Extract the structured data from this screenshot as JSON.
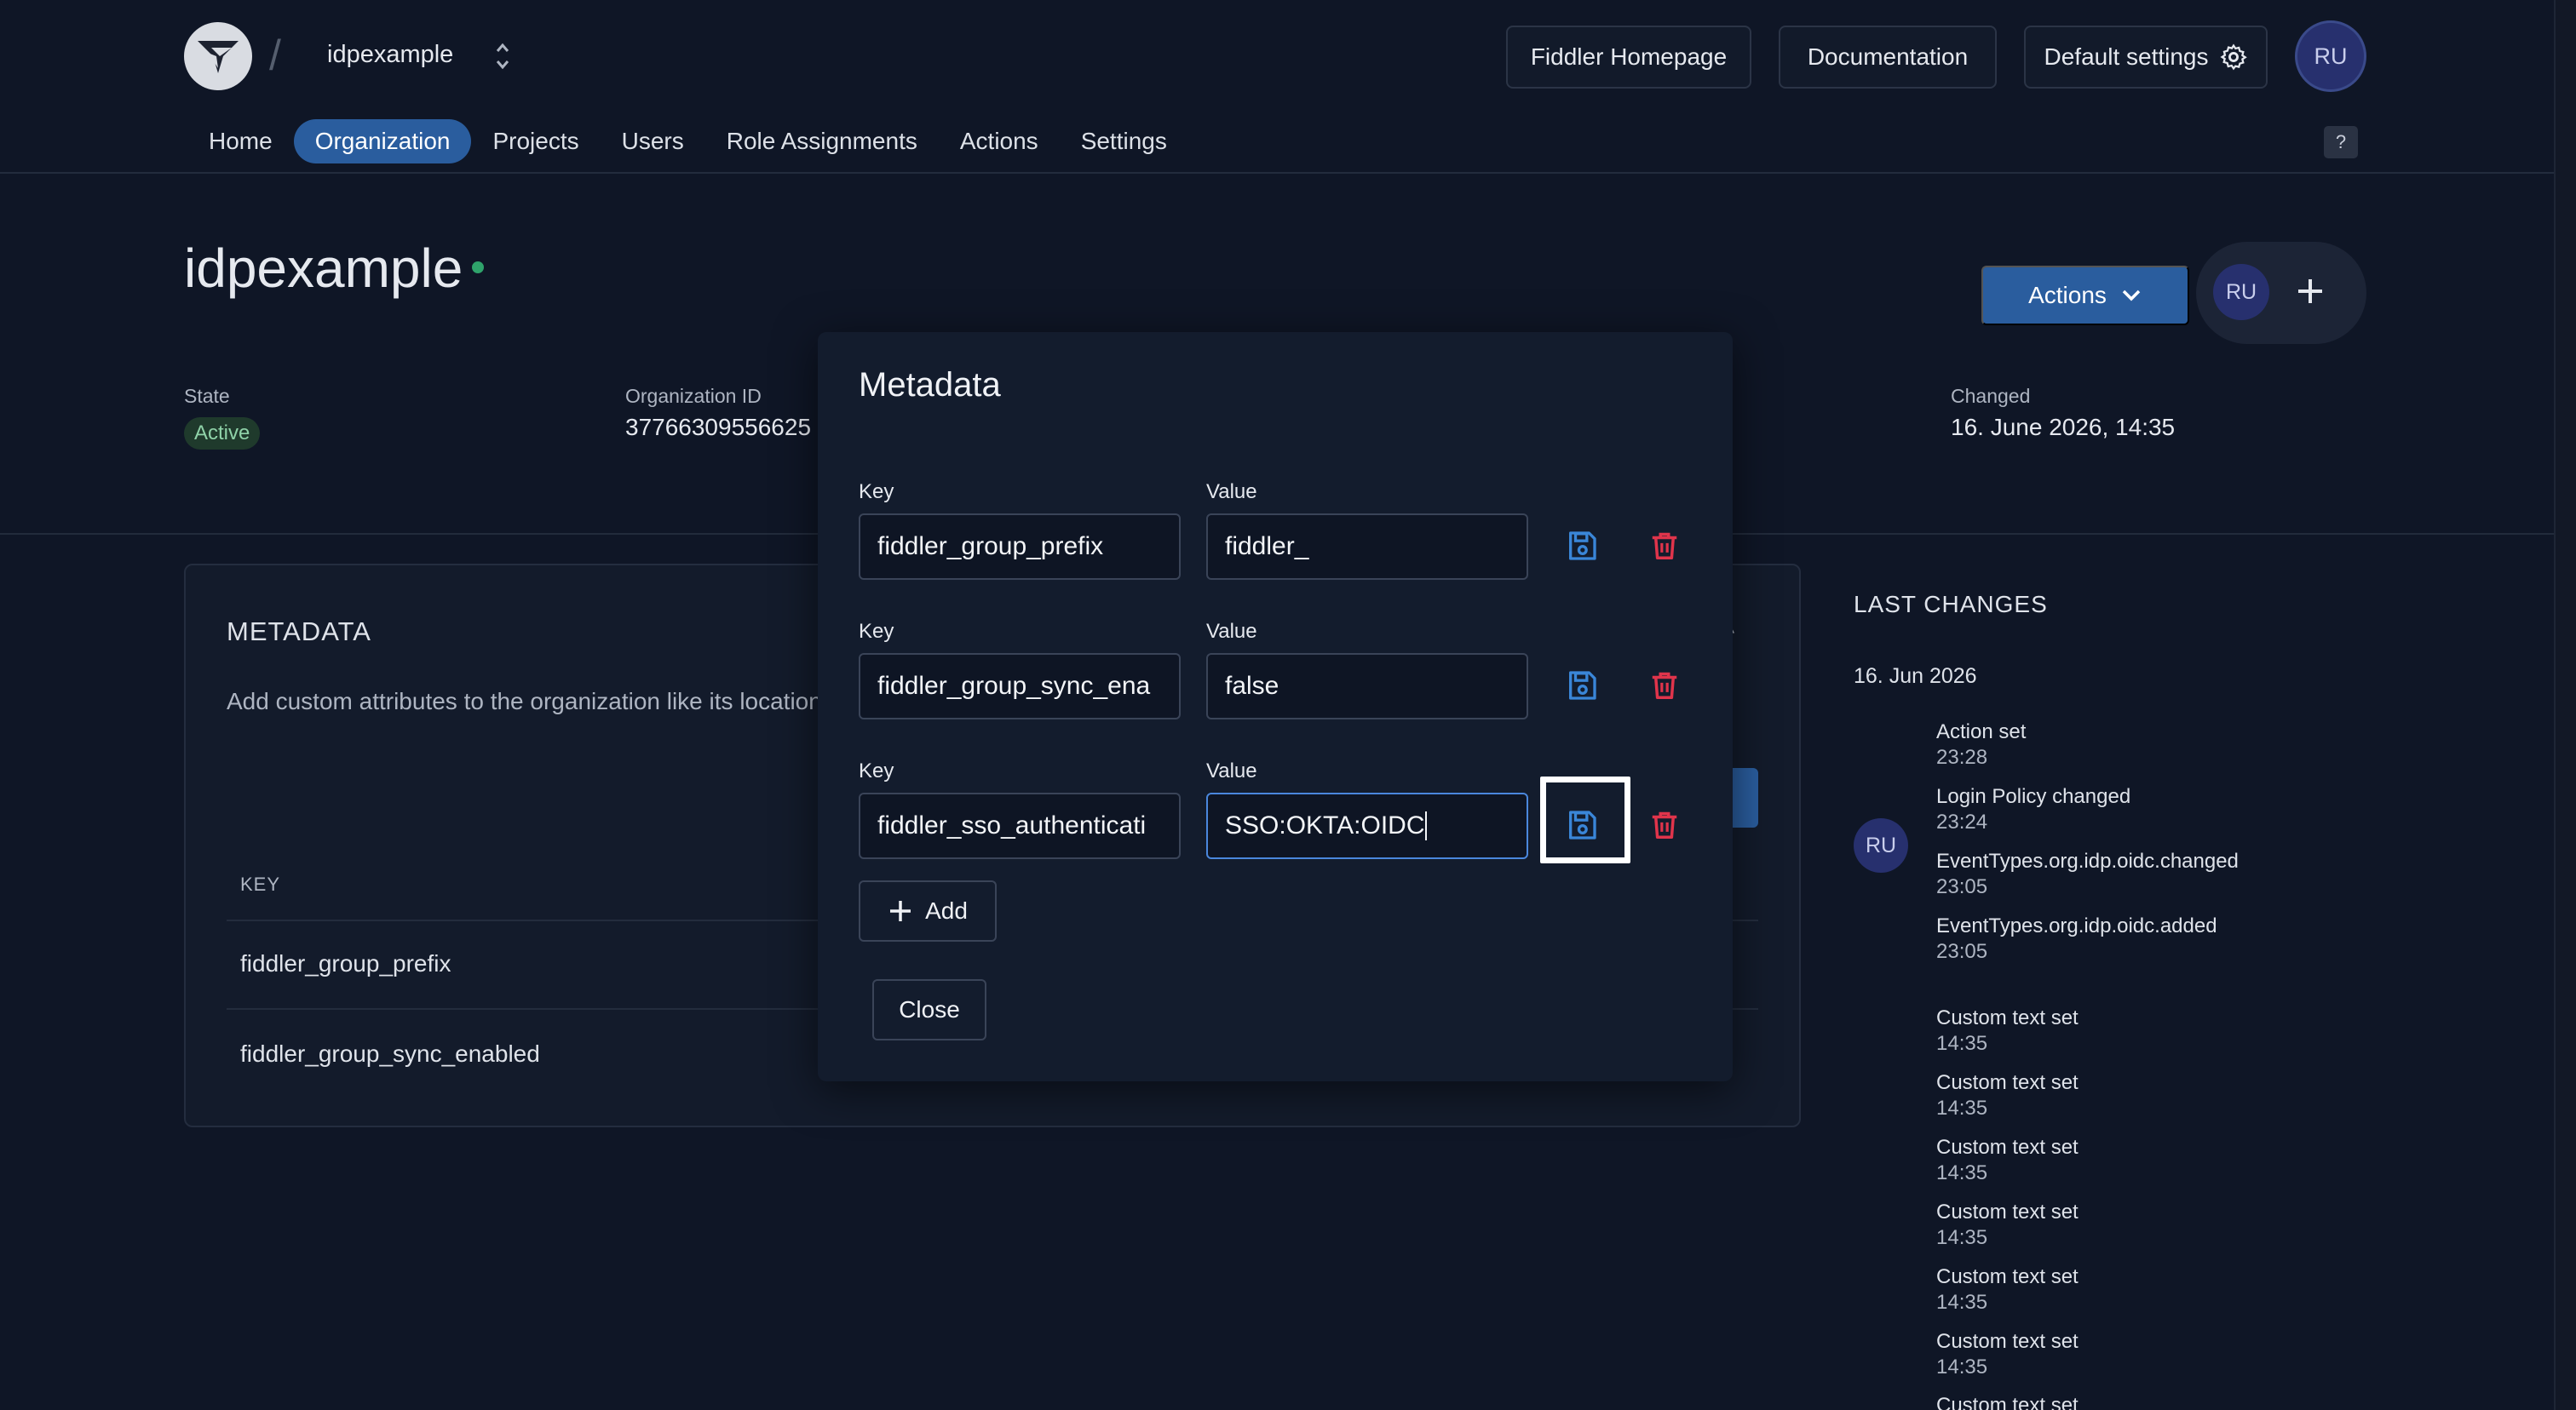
{
  "header": {
    "org_name": "idpexample",
    "buttons": {
      "homepage": "Fiddler Homepage",
      "documentation": "Documentation",
      "default_settings": "Default settings"
    },
    "user_initials": "RU",
    "help": "?"
  },
  "nav": {
    "items": [
      "Home",
      "Organization",
      "Projects",
      "Users",
      "Role Assignments",
      "Actions",
      "Settings"
    ],
    "active": "Organization"
  },
  "page": {
    "title": "idpexample",
    "actions_label": "Actions",
    "member_initials": "RU",
    "info": {
      "state_label": "State",
      "state_value": "Active",
      "org_id_label": "Organization ID",
      "org_id_value": "37766309556625",
      "changed_label": "Changed",
      "changed_value": "16. June 2026, 14:35"
    }
  },
  "metadata_card": {
    "title": "METADATA",
    "description": "Add custom attributes to the organization like its location",
    "column_key": "KEY",
    "rows": [
      "fiddler_group_prefix",
      "fiddler_group_sync_enabled"
    ]
  },
  "last_changes": {
    "title": "LAST CHANGES",
    "date": "16. Jun 2026",
    "avatar": "RU",
    "entries": [
      {
        "text": "Action set",
        "time": "23:28"
      },
      {
        "text": "Login Policy changed",
        "time": "23:24"
      },
      {
        "text": "EventTypes.org.idp.oidc.changed",
        "time": "23:05"
      },
      {
        "text": "EventTypes.org.idp.oidc.added",
        "time": "23:05"
      },
      {
        "text": "Custom text set",
        "time": "14:35"
      },
      {
        "text": "Custom text set",
        "time": "14:35"
      },
      {
        "text": "Custom text set",
        "time": "14:35"
      },
      {
        "text": "Custom text set",
        "time": "14:35"
      },
      {
        "text": "Custom text set",
        "time": "14:35"
      },
      {
        "text": "Custom text set",
        "time": "14:35"
      },
      {
        "text": "Custom text set",
        "time": ""
      }
    ]
  },
  "modal": {
    "title": "Metadata",
    "key_label": "Key",
    "value_label": "Value",
    "rows": [
      {
        "key": "fiddler_group_prefix",
        "value": "fiddler_"
      },
      {
        "key": "fiddler_group_sync_ena",
        "value": "false"
      },
      {
        "key": "fiddler_sso_authenticati",
        "value": "SSO:OKTA:OIDC"
      }
    ],
    "add_label": "Add",
    "close_label": "Close"
  },
  "colors": {
    "background": "#0f1626",
    "accent": "#2a5d9e",
    "save_icon": "#3a86d8",
    "delete_icon": "#e0344b",
    "active_dot": "#2fa36b"
  },
  "icons": {
    "save": "floppy-disk-icon",
    "delete": "trash-icon",
    "settings": "gear-icon",
    "expand": "chevron-down-icon",
    "switcher": "chevron-updown-icon"
  }
}
